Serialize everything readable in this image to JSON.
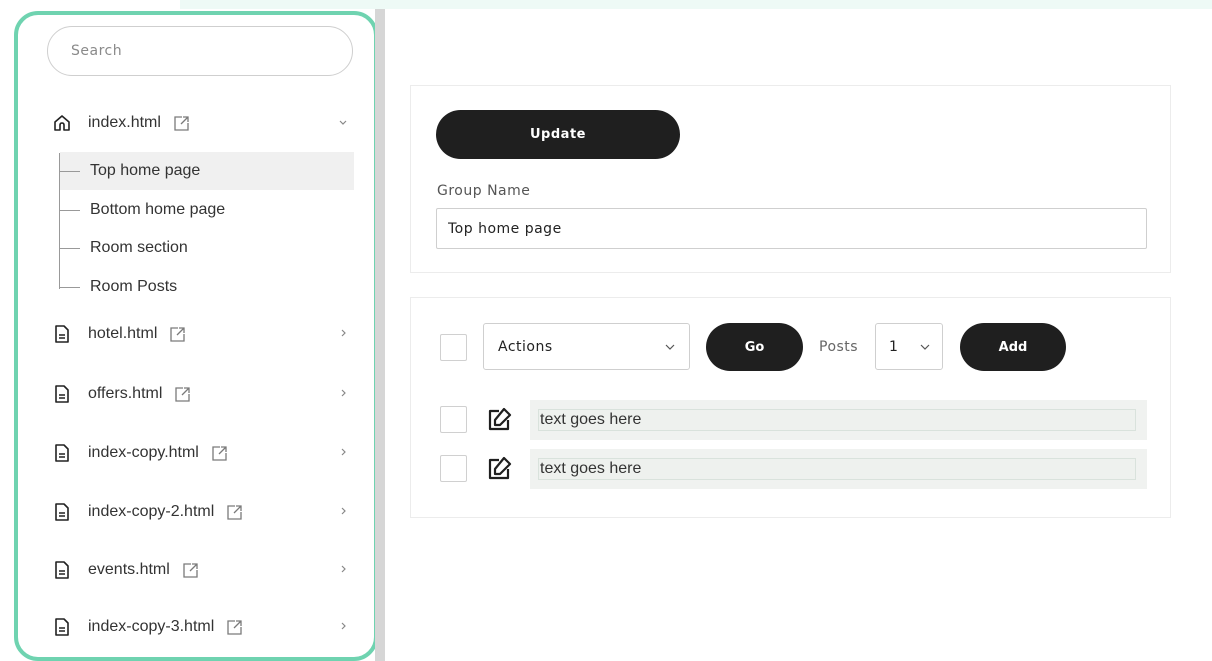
{
  "sidebar": {
    "search": {
      "placeholder": "Search"
    },
    "items": [
      {
        "label": "index.html",
        "icon": "home-icon",
        "expanded": true,
        "children": [
          "Top home page",
          "Bottom home page",
          "Room section",
          "Room Posts"
        ]
      },
      {
        "label": "hotel.html",
        "icon": "file-icon",
        "expanded": false
      },
      {
        "label": "offers.html",
        "icon": "file-icon",
        "expanded": false
      },
      {
        "label": "index-copy.html",
        "icon": "file-icon",
        "expanded": false
      },
      {
        "label": "index-copy-2.html",
        "icon": "file-icon",
        "expanded": false
      },
      {
        "label": "events.html",
        "icon": "file-icon",
        "expanded": false
      },
      {
        "label": "index-copy-3.html",
        "icon": "file-icon",
        "expanded": false
      }
    ],
    "active_child": "Top home page"
  },
  "group_panel": {
    "update_label": "Update",
    "group_name_label": "Group Name",
    "group_name_value": "Top home page"
  },
  "posts_panel": {
    "actions_select": "Actions",
    "go_label": "Go",
    "posts_label": "Posts",
    "posts_select": "1",
    "add_label": "Add",
    "rows": [
      {
        "text": "text goes here"
      },
      {
        "text": "text goes here"
      }
    ]
  },
  "colors": {
    "accent_border": "#6fd3b0",
    "button_bg": "#1f1f1f",
    "active_item_bg": "#f0f0f0"
  }
}
